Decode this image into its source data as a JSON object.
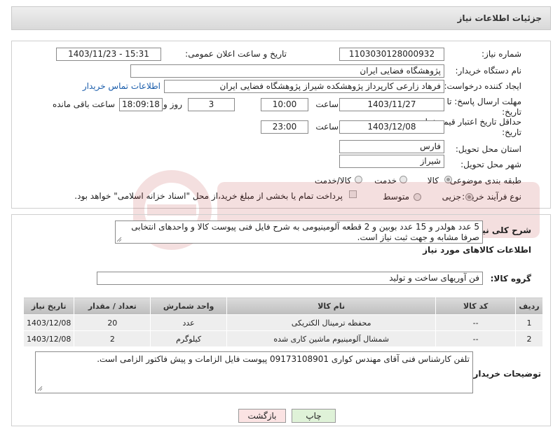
{
  "header": {
    "title": "جزئیات اطلاعات نیاز"
  },
  "fields": {
    "need_number_label": "شماره نیاز:",
    "need_number": "1103030128000932",
    "announce_label": "تاریخ و ساعت اعلان عمومی:",
    "announce_value": "1403/11/23 - 15:31",
    "buyer_org_label": "نام دستگاه خریدار:",
    "buyer_org": "پژوهشگاه فضایی ایران",
    "creator_label": "ایجاد کننده درخواست:",
    "creator": "فرهاد زارعی کارپرداز پژوهشکده شیراز پژوهشگاه فضایی ایران",
    "contact_link": "اطلاعات تماس خریدار",
    "deadline_label_1": "مهلت ارسال پاسخ: تا",
    "deadline_label_2": "تاریخ:",
    "deadline_date": "1403/11/27",
    "time_label": "ساعت",
    "deadline_time": "10:00",
    "days_value": "3",
    "days_label": "روز و",
    "remaining_time": "18:09:18",
    "remaining_label": "ساعت باقی مانده",
    "validity_label_1": "حداقل تاریخ اعتبار قیمت: تا",
    "validity_label_2": "تاریخ:",
    "validity_date": "1403/12/08",
    "validity_time": "23:00",
    "province_label": "استان محل تحویل:",
    "province": "فارس",
    "city_label": "شهر محل تحویل:",
    "city": "شیراز",
    "category_label": "طبقه بندی موضوعی:",
    "cat_goods": "کالا",
    "cat_service": "خدمت",
    "cat_goods_service": "کالا/خدمت",
    "process_label": "نوع فرآیند خرید :",
    "proc_minor": "جزیی",
    "proc_medium": "متوسط",
    "payment_note": "پرداخت تمام یا بخشی از مبلغ خرید،از محل \"اسناد خزانه اسلامی\" خواهد بود."
  },
  "description": {
    "label": "شرح کلی نیاز:",
    "text": "5 عدد هولدر و 15 عدد بوبین و 2 قطعه آلومینیومی به شرح فایل فنی پیوست کالا و واحدهای انتخابی صرفا مشابه و جهت ثبت نیاز است."
  },
  "goods_section": {
    "title": "اطلاعات کالاهای مورد نیاز",
    "group_label": "گروه کالا:",
    "group_value": "فن آوریهای ساخت و تولید"
  },
  "table": {
    "headers": [
      "ردیف",
      "کد کالا",
      "نام کالا",
      "واحد شمارش",
      "تعداد / مقدار",
      "تاریخ نیاز"
    ],
    "rows": [
      [
        "1",
        "--",
        "محفظه ترمینال الکتریکی",
        "عدد",
        "20",
        "1403/12/08"
      ],
      [
        "2",
        "--",
        "شمشال آلومینیوم ماشین کاری شده",
        "کیلوگرم",
        "2",
        "1403/12/08"
      ]
    ]
  },
  "buyer_notes": {
    "label": "توضیحات خریدار:",
    "text": "تلفن کارشناس فنی آقای مهندس کواری 09173108901 پیوست فایل الزامات و پیش فاکتور الزامی است."
  },
  "buttons": {
    "print": "چاپ",
    "back": "بازگشت"
  },
  "colors": {
    "print_bg": "#dff2d8",
    "back_bg": "#fbe3e3",
    "link": "#1a5dab"
  }
}
